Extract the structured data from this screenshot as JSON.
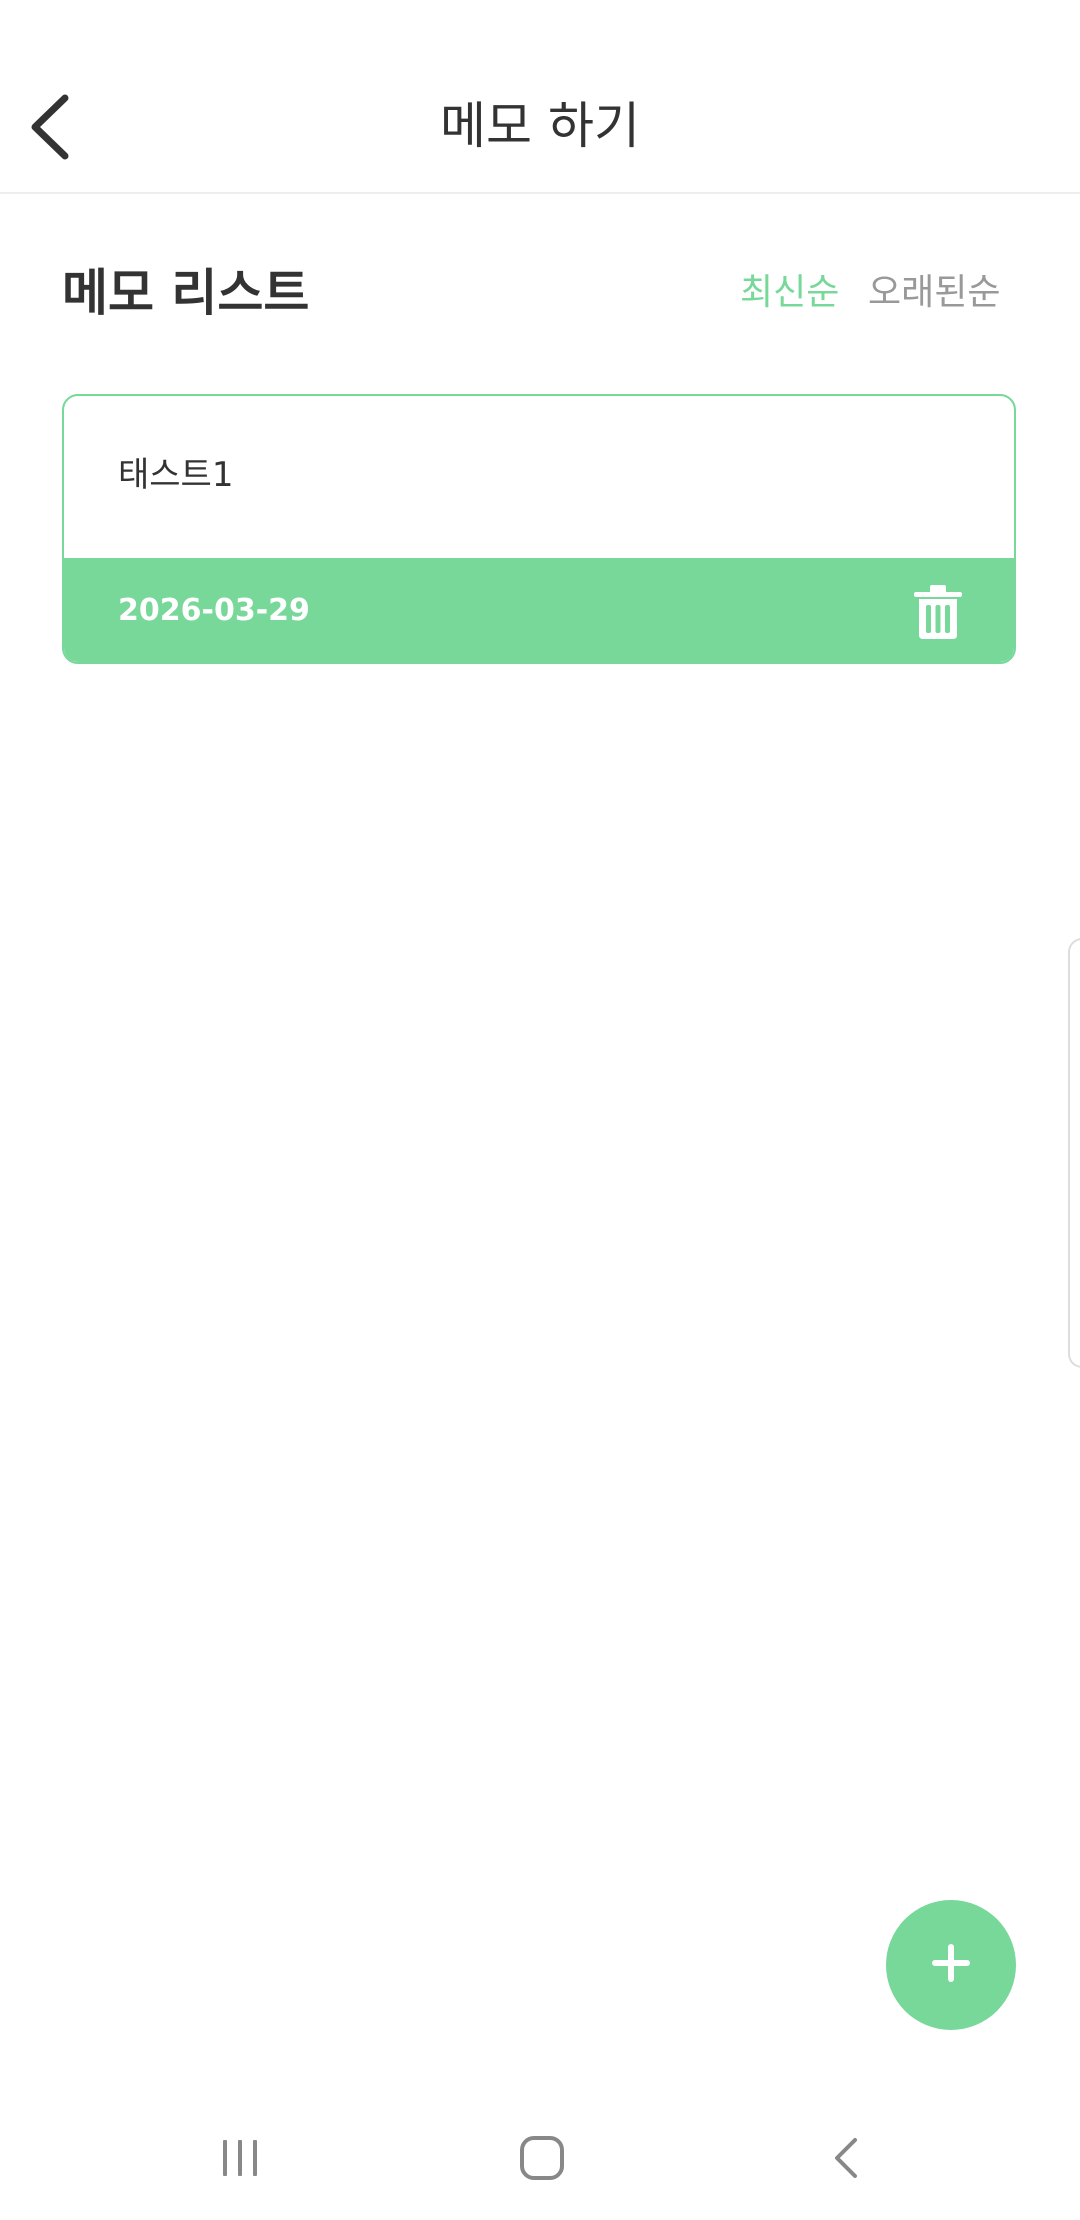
{
  "header": {
    "title": "메모 하기",
    "back_icon": "chevron-left-icon"
  },
  "section": {
    "title": "메모 리스트",
    "sort_options": [
      {
        "label": "최신순",
        "active": true
      },
      {
        "label": "오래된순",
        "active": false
      }
    ]
  },
  "memos": [
    {
      "title": "태스트1",
      "date": "2026-03-29",
      "delete_icon": "trash-icon"
    }
  ],
  "fab": {
    "icon": "plus-icon"
  },
  "nav": {
    "recents_icon": "recents-icon",
    "home_icon": "home-icon",
    "back_icon": "back-icon"
  },
  "colors": {
    "accent": "#77d899",
    "text": "#333333",
    "muted": "#999999"
  }
}
